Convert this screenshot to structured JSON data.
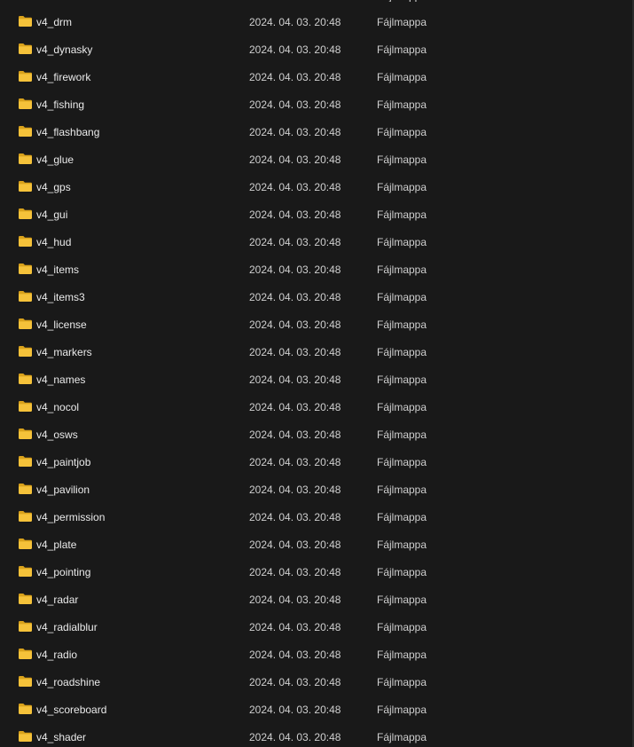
{
  "partial_top_row": {
    "type": "Fájlmappa"
  },
  "rows": [
    {
      "name": "v4_drm",
      "date": "2024. 04. 03. 20:48",
      "type": "Fájlmappa",
      "icon": "folder-icon"
    },
    {
      "name": "v4_dynasky",
      "date": "2024. 04. 03. 20:48",
      "type": "Fájlmappa",
      "icon": "folder-icon"
    },
    {
      "name": "v4_firework",
      "date": "2024. 04. 03. 20:48",
      "type": "Fájlmappa",
      "icon": "folder-icon"
    },
    {
      "name": "v4_fishing",
      "date": "2024. 04. 03. 20:48",
      "type": "Fájlmappa",
      "icon": "folder-icon"
    },
    {
      "name": "v4_flashbang",
      "date": "2024. 04. 03. 20:48",
      "type": "Fájlmappa",
      "icon": "folder-icon"
    },
    {
      "name": "v4_glue",
      "date": "2024. 04. 03. 20:48",
      "type": "Fájlmappa",
      "icon": "folder-icon"
    },
    {
      "name": "v4_gps",
      "date": "2024. 04. 03. 20:48",
      "type": "Fájlmappa",
      "icon": "folder-icon"
    },
    {
      "name": "v4_gui",
      "date": "2024. 04. 03. 20:48",
      "type": "Fájlmappa",
      "icon": "folder-icon"
    },
    {
      "name": "v4_hud",
      "date": "2024. 04. 03. 20:48",
      "type": "Fájlmappa",
      "icon": "folder-icon"
    },
    {
      "name": "v4_items",
      "date": "2024. 04. 03. 20:48",
      "type": "Fájlmappa",
      "icon": "folder-icon"
    },
    {
      "name": "v4_items3",
      "date": "2024. 04. 03. 20:48",
      "type": "Fájlmappa",
      "icon": "folder-icon"
    },
    {
      "name": "v4_license",
      "date": "2024. 04. 03. 20:48",
      "type": "Fájlmappa",
      "icon": "folder-icon"
    },
    {
      "name": "v4_markers",
      "date": "2024. 04. 03. 20:48",
      "type": "Fájlmappa",
      "icon": "folder-icon"
    },
    {
      "name": "v4_names",
      "date": "2024. 04. 03. 20:48",
      "type": "Fájlmappa",
      "icon": "folder-icon"
    },
    {
      "name": "v4_nocol",
      "date": "2024. 04. 03. 20:48",
      "type": "Fájlmappa",
      "icon": "folder-icon"
    },
    {
      "name": "v4_osws",
      "date": "2024. 04. 03. 20:48",
      "type": "Fájlmappa",
      "icon": "folder-icon"
    },
    {
      "name": "v4_paintjob",
      "date": "2024. 04. 03. 20:48",
      "type": "Fájlmappa",
      "icon": "folder-icon"
    },
    {
      "name": "v4_pavilion",
      "date": "2024. 04. 03. 20:48",
      "type": "Fájlmappa",
      "icon": "folder-icon"
    },
    {
      "name": "v4_permission",
      "date": "2024. 04. 03. 20:48",
      "type": "Fájlmappa",
      "icon": "folder-icon"
    },
    {
      "name": "v4_plate",
      "date": "2024. 04. 03. 20:48",
      "type": "Fájlmappa",
      "icon": "folder-icon"
    },
    {
      "name": "v4_pointing",
      "date": "2024. 04. 03. 20:48",
      "type": "Fájlmappa",
      "icon": "folder-icon"
    },
    {
      "name": "v4_radar",
      "date": "2024. 04. 03. 20:48",
      "type": "Fájlmappa",
      "icon": "folder-icon"
    },
    {
      "name": "v4_radialblur",
      "date": "2024. 04. 03. 20:48",
      "type": "Fájlmappa",
      "icon": "folder-icon"
    },
    {
      "name": "v4_radio",
      "date": "2024. 04. 03. 20:48",
      "type": "Fájlmappa",
      "icon": "folder-icon"
    },
    {
      "name": "v4_roadshine",
      "date": "2024. 04. 03. 20:48",
      "type": "Fájlmappa",
      "icon": "folder-icon"
    },
    {
      "name": "v4_scoreboard",
      "date": "2024. 04. 03. 20:48",
      "type": "Fájlmappa",
      "icon": "folder-icon"
    },
    {
      "name": "v4_shader",
      "date": "2024. 04. 03. 20:48",
      "type": "Fájlmappa",
      "icon": "folder-icon"
    }
  ],
  "colors": {
    "background": "#191919",
    "folder": "#f5c23a",
    "folder_dark": "#d9a21c",
    "text": "#eaeaea"
  }
}
